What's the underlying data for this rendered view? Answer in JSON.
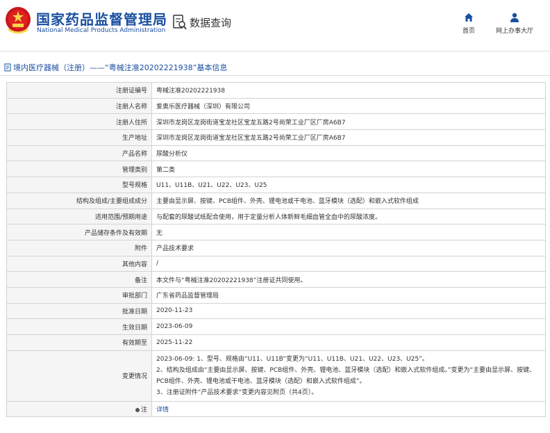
{
  "header": {
    "brand_cn": "国家药品监督管理局",
    "brand_en": "National Medical Products Administration",
    "query_title": "数据查询",
    "nav": [
      {
        "label": "首页",
        "icon": "home-icon"
      },
      {
        "label": "网上办事大厅",
        "icon": "user-icon"
      }
    ]
  },
  "breadcrumb": "境内医疗器械（注册）——“粤械注准20202221938”基本信息",
  "rows": [
    {
      "key": "注册证编号",
      "value": "粤械注准20202221938"
    },
    {
      "key": "注册人名称",
      "value": "爱奥乐医疗器械（深圳）有限公司"
    },
    {
      "key": "注册人住所",
      "value": "深圳市龙岗区龙岗街道宝龙社区宝龙五路2号尚荣工业厂区厂房A6B7"
    },
    {
      "key": "生产地址",
      "value": "深圳市龙岗区龙岗街道宝龙社区宝龙五路2号尚荣工业厂区厂房A6B7"
    },
    {
      "key": "产品名称",
      "value": "尿酸分析仪"
    },
    {
      "key": "管理类别",
      "value": "第二类"
    },
    {
      "key": "型号规格",
      "value": "U11、U11B、U21、U22、U23、U25"
    },
    {
      "key": "结构及组成/主要组成成分",
      "value": "主要由显示屏、按键、PCB组件、外壳、锂电池或干电池、蓝牙模块（选配）和嵌入式软件组成"
    },
    {
      "key": "适用范围/预期用途",
      "value": "与配套的尿酸试纸配合使用，用于定量分析人体新鲜毛细血管全血中的尿酸浓度。"
    },
    {
      "key": "产品储存条件及有效期",
      "value": "无"
    },
    {
      "key": "附件",
      "value": "产品技术要求"
    },
    {
      "key": "其他内容",
      "value": "/"
    },
    {
      "key": "备注",
      "value": "本文件与“粤械注准20202221938”注册证共同使用。"
    },
    {
      "key": "审批部门",
      "value": "广东省药品监督管理局"
    },
    {
      "key": "批准日期",
      "value": "2020-11-23"
    },
    {
      "key": "生效日期",
      "value": "2023-06-09"
    },
    {
      "key": "有效期至",
      "value": "2025-11-22"
    }
  ],
  "changes": {
    "key": "变更情况",
    "lines": [
      "2023-06-09: 1、型号、规格由“U11、U11B”变更为“U11、U11B、U21、U22、U23、U25”。",
      "2、结构及组成由“主要由显示屏、按键、PCB组件、外壳、锂电池、蓝牙模块（选配）和嵌入式软件组成。”变更为“主要由显示屏、按键、PCB组件、外壳、锂电池或干电池、蓝牙模块（选配）和嵌入式软件组成”。",
      "3、注册证附件“产品技术要求”变更内容见附页（共4页）。"
    ]
  },
  "note": {
    "key": "注",
    "link": "详情"
  },
  "colors": {
    "brand": "#1a4fa0",
    "border": "#d3d3d3",
    "key_bg": "#f5f5f5"
  }
}
